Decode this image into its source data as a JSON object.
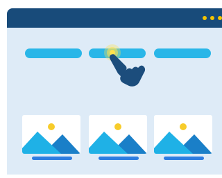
{
  "colors": {
    "page_background": "#ffffff",
    "window_background": "#deebf7",
    "titlebar": "#184b7a",
    "window_dots": "#f5c400",
    "menu_pills": "#29b6e8",
    "card_background": "#ffffff",
    "mountain_front": "#1fb1e6",
    "mountain_back": "#1a7fc8",
    "sun": "#f7cc2a",
    "caption_bars": "#2e7de0",
    "hand": "#1c4d7c",
    "touch_glow": "#ffe14d"
  },
  "titlebar": {
    "window_controls": [
      "dot",
      "dot",
      "dot"
    ]
  },
  "menu": {
    "items": [
      {
        "icon": "menu-pill",
        "active": false
      },
      {
        "icon": "menu-pill",
        "active": true
      },
      {
        "icon": "menu-pill",
        "active": false
      }
    ]
  },
  "gallery": {
    "cards": [
      {
        "icon": "image-placeholder-icon"
      },
      {
        "icon": "image-placeholder-icon"
      },
      {
        "icon": "image-placeholder-icon"
      }
    ]
  },
  "pointer": {
    "icon": "pointing-hand-icon",
    "gesture": "tap"
  }
}
